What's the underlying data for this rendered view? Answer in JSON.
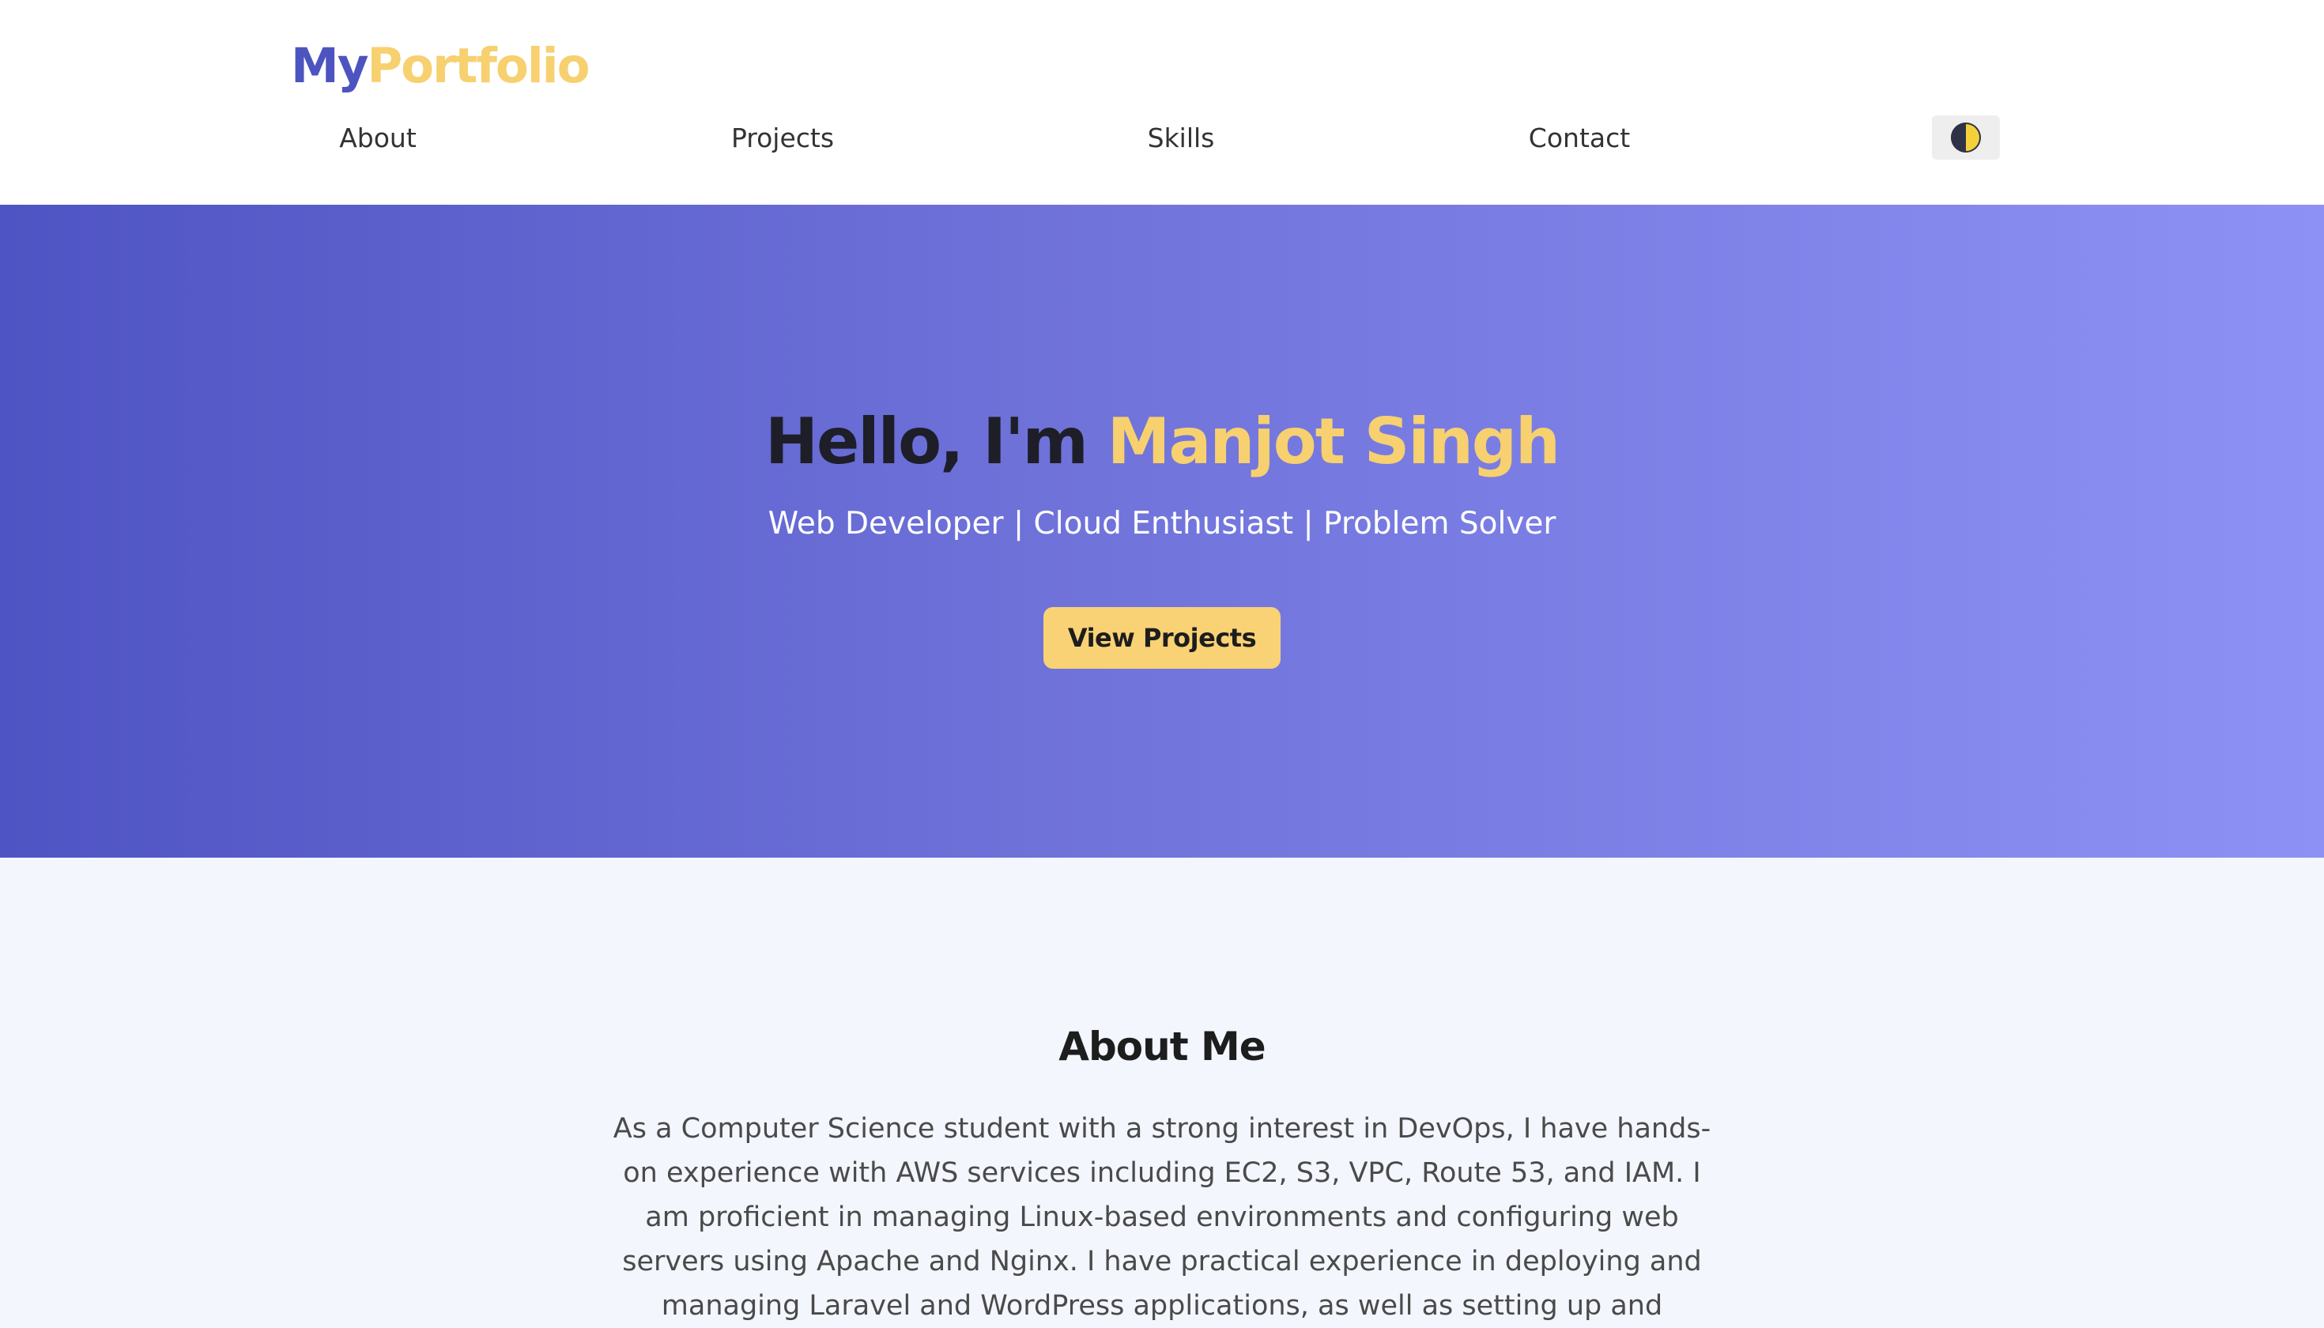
{
  "header": {
    "logo_my": "My",
    "logo_portfolio": "Portfolio",
    "nav": [
      {
        "label": "About"
      },
      {
        "label": "Projects"
      },
      {
        "label": "Skills"
      },
      {
        "label": "Contact"
      }
    ],
    "theme_toggle_icon": "half-moon-icon"
  },
  "hero": {
    "greeting": "Hello, I'm ",
    "name": "Manjot Singh",
    "subtitle": "Web Developer | Cloud Enthusiast | Problem Solver",
    "cta_label": "View Projects"
  },
  "about": {
    "title": "About Me",
    "text": "As a Computer Science student with a strong interest in DevOps, I have hands-on experience with AWS services including EC2, S3, VPC, Route 53, and IAM. I am proficient in managing Linux-based environments and configuring web servers using Apache and Nginx. I have practical experience in deploying and managing Laravel and WordPress applications, as well as setting up and"
  },
  "colors": {
    "brand_primary": "#4d54c0",
    "brand_accent": "#f7d06f",
    "hero_gradient_start": "#4f54c4",
    "hero_gradient_end": "#8d91f5",
    "about_bg": "#f3f6fd"
  }
}
